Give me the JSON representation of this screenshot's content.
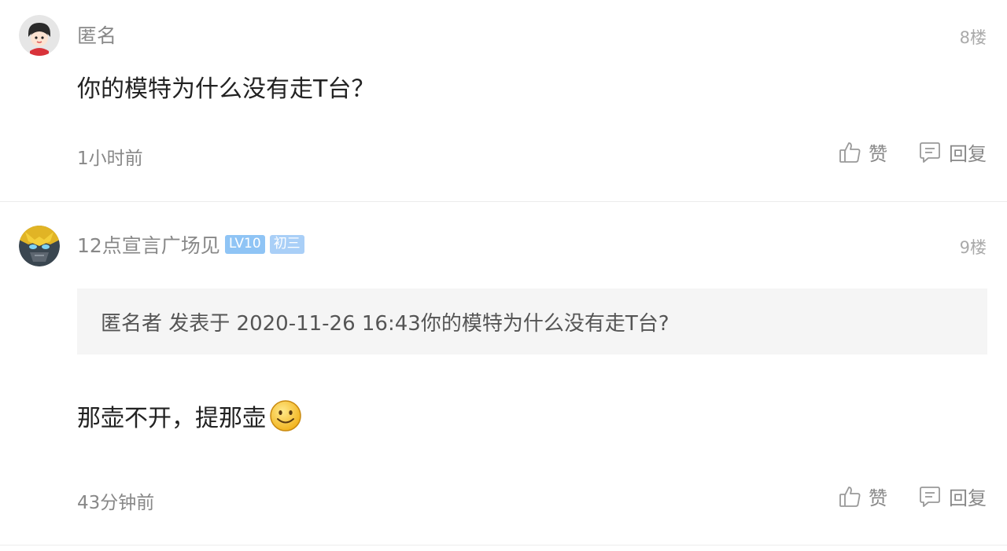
{
  "comments": [
    {
      "author": "匿名",
      "floor": "8楼",
      "content": "你的模特为什么没有走T台？",
      "time": "1小时前",
      "like_label": "赞",
      "reply_label": "回复"
    },
    {
      "author": "12点宣言广场见",
      "level_badge": "LV10",
      "grade_badge": "初三",
      "floor": "9楼",
      "quote": "匿名者 发表于 2020-11-26 16:43你的模特为什么没有走T台?",
      "content": "那壶不开，提那壶",
      "emoji": "smile-emoji",
      "time": "43分钟前",
      "like_label": "赞",
      "reply_label": "回复"
    }
  ],
  "colors": {
    "badge_level": "#8fc4f5",
    "badge_grade": "#a9cff7",
    "quote_bg": "#f5f5f5",
    "meta_text": "#888888"
  }
}
